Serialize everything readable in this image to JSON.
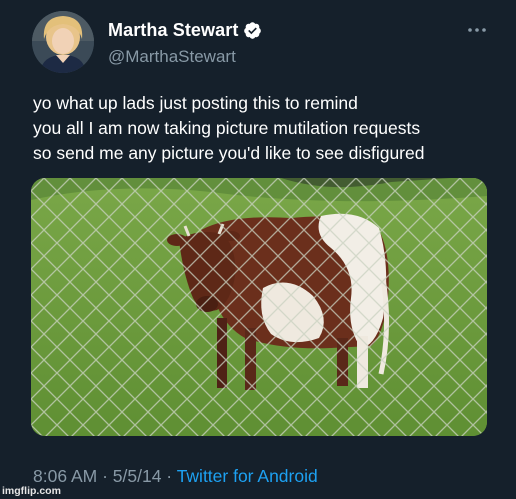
{
  "author": {
    "display_name": "Martha Stewart",
    "handle": "@MarthaStewart",
    "verified": true
  },
  "tweet": {
    "text_lines": [
      "yo what up lads just posting this to remind",
      "you all I am now taking picture mutilation requests",
      "so send me any picture you'd like to see disfigured"
    ],
    "time": "8:06 AM",
    "date": "5/5/14",
    "separator": " · ",
    "source": "Twitter for Android"
  },
  "watermark": "imgflip.com",
  "icons": {
    "more": "more-options-icon",
    "verified": "verified-badge-icon"
  },
  "colors": {
    "background": "#15202b",
    "secondary_text": "#8899a6",
    "link": "#1da1f2",
    "verified": "#ffffff"
  }
}
